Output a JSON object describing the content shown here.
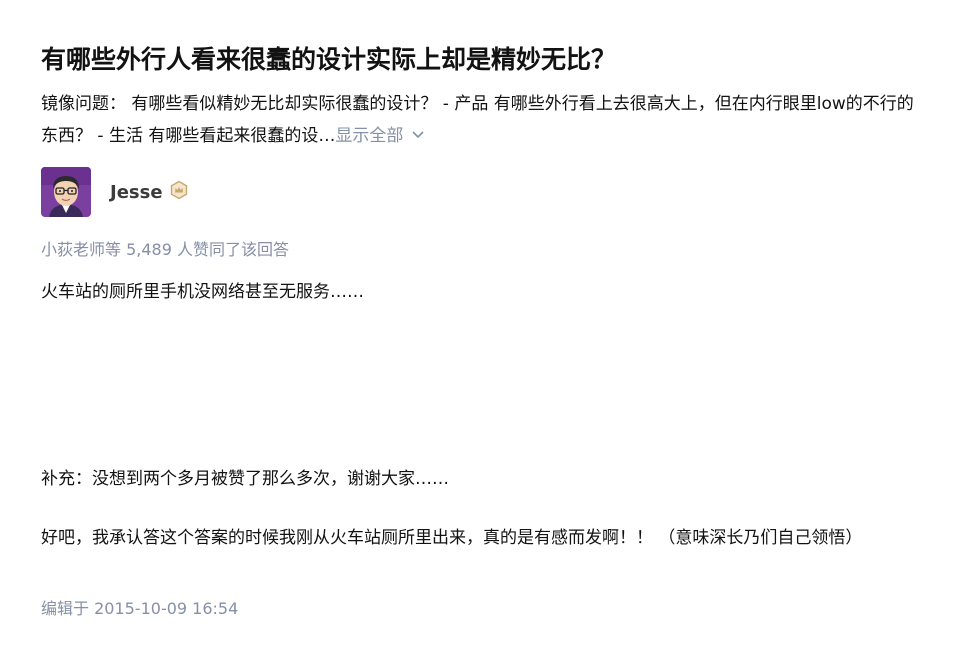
{
  "question": {
    "title": "有哪些外行人看来很蠢的设计实际上却是精妙无比？",
    "description_excerpt": "镜像问题： 有哪些看似精妙无比却实际很蠢的设计？ - 产品 有哪些外行看上去很高大上，但在内行眼里low的不行的东西？ - 生活 有哪些看起来很蠢的设…",
    "show_all_label": "显示全部",
    "show_all_icon": "chevron-down-icon"
  },
  "answer": {
    "author": {
      "name": "Jesse",
      "avatar_icon": "avatar-icon",
      "badge_icon": "crown-badge-icon"
    },
    "votes_text": "小荻老师等 5,489 人赞同了该回答",
    "paragraphs": [
      "火车站的厕所里手机没网络甚至无服务……",
      "补充：没想到两个多月被赞了那么多次，谢谢大家……",
      "好吧，我承认答这个答案的时候我刚从火车站厕所里出来，真的是有感而发啊！！ （意味深长乃们自己领悟）"
    ],
    "edited_text": "编辑于 2015-10-09 16:54"
  },
  "colors": {
    "text": "#121212",
    "muted": "#8590a6",
    "avatar_bg": "#7b3fa0",
    "badge": "#c9a76b"
  }
}
